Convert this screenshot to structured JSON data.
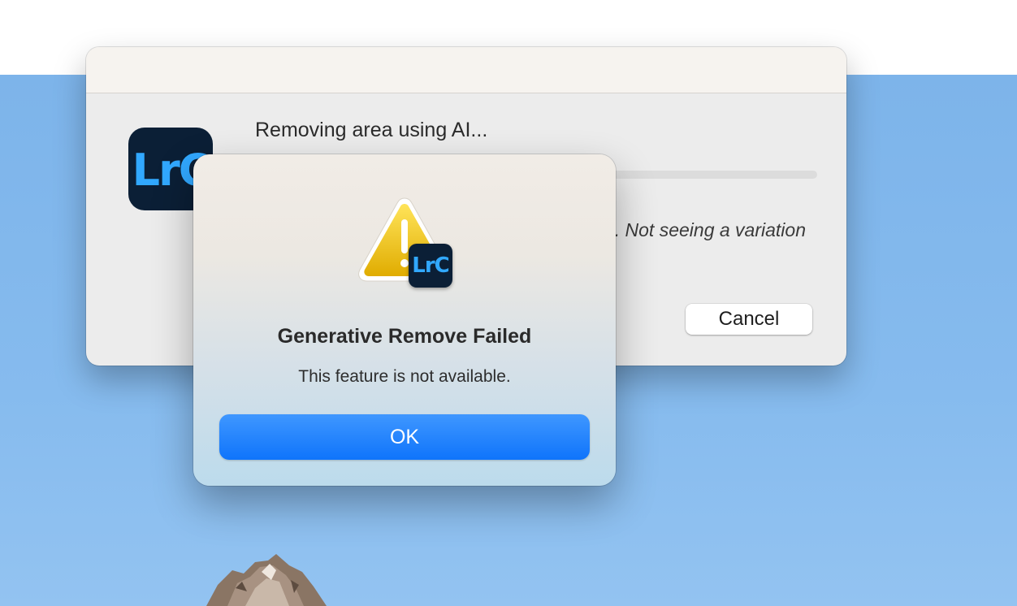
{
  "progress_dialog": {
    "app_icon_text": "LrC",
    "message": "Removing area using AI...",
    "hint_text": ". Not seeing a variation",
    "cancel_label": "Cancel"
  },
  "alert": {
    "icon": "warning-icon",
    "badge_text": "LrC",
    "title": "Generative Remove Failed",
    "message": "This feature is not available.",
    "ok_label": "OK"
  },
  "colors": {
    "accent": "#0f74fb",
    "lrc_background": "#0b1f36",
    "lrc_text": "#31a8ff",
    "backdrop_sky": "#86bbee"
  }
}
